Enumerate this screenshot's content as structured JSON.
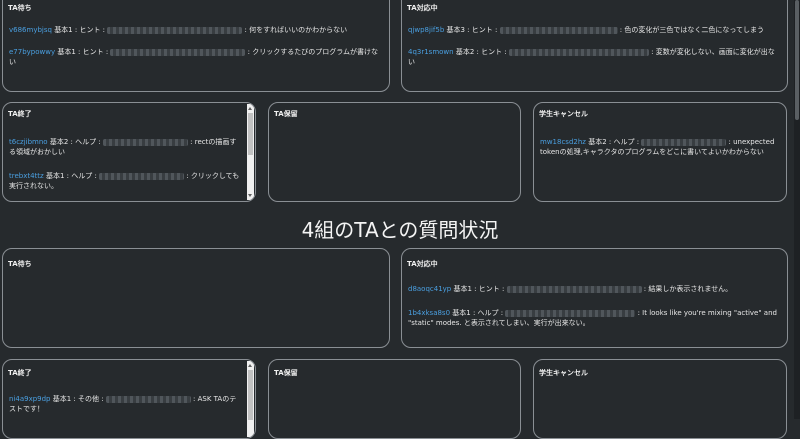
{
  "section1": {
    "ta_waiting": {
      "title": "TA待ち",
      "entries": [
        {
          "student_id": "v686mybjsq",
          "text": "基本1 : ヒント : ",
          "tail": " : 何をすればいいのかわからない"
        },
        {
          "student_id": "e77bypowwy",
          "text": "基本1 : ヒント : ",
          "tail": " : クリックするたびのプログラムが書けない"
        }
      ]
    },
    "ta_handling": {
      "title": "TA対応中",
      "entries": [
        {
          "student_id": "qjwp8jif5b",
          "text": "基本3 : ヒント : ",
          "tail": " : 色の変化が三色ではなく二色になってしまう"
        },
        {
          "student_id": "4q3r1smown",
          "text": "基本2 : ヒント : ",
          "tail": " : 変数が変化しない、画面に変化が出ない"
        }
      ]
    },
    "ta_done": {
      "title": "TA終了",
      "entries": [
        {
          "student_id": "t6czjibmno",
          "text": "基本2 : ヘルプ : ",
          "tail": " : rectの描画する領域がおかしい"
        },
        {
          "student_id": "trebxt4ttz",
          "text": "基本1 : ヘルプ : ",
          "tail": " : クリックしても実行されない。"
        }
      ]
    },
    "ta_hold": {
      "title": "TA保留",
      "entries": []
    },
    "student_cancel": {
      "title": "学生キャンセル",
      "entries": [
        {
          "student_id": "mw18csd2hz",
          "text": "基本2 : ヘルプ : ",
          "tail": " : unexpected tokenの処理,キャラクタのプログラムをどこに書いてよいかわからない"
        }
      ]
    }
  },
  "section2": {
    "heading": "4組のTAとの質問状況",
    "ta_waiting": {
      "title": "TA待ち",
      "entries": []
    },
    "ta_handling": {
      "title": "TA対応中",
      "entries": [
        {
          "student_id": "d8aoqc41yp",
          "text": "基本1 : ヒント : ",
          "tail": " : 結果しか表示されません。"
        },
        {
          "student_id": "1b4xksa8s0",
          "text": "基本1 : ヘルプ : ",
          "tail": " : It looks like you're mixing \"active\" and \"static\" modes. と表示されてしまい、実行が出来ない。"
        }
      ]
    },
    "ta_done": {
      "title": "TA終了",
      "entries": [
        {
          "student_id": "ni4a9xp9dp",
          "text": "基本1 : その他 : ",
          "tail": " : ASK TAのテストです！"
        }
      ]
    },
    "ta_hold": {
      "title": "TA保留",
      "entries": []
    },
    "student_cancel": {
      "title": "学生キャンセル",
      "entries": []
    }
  }
}
